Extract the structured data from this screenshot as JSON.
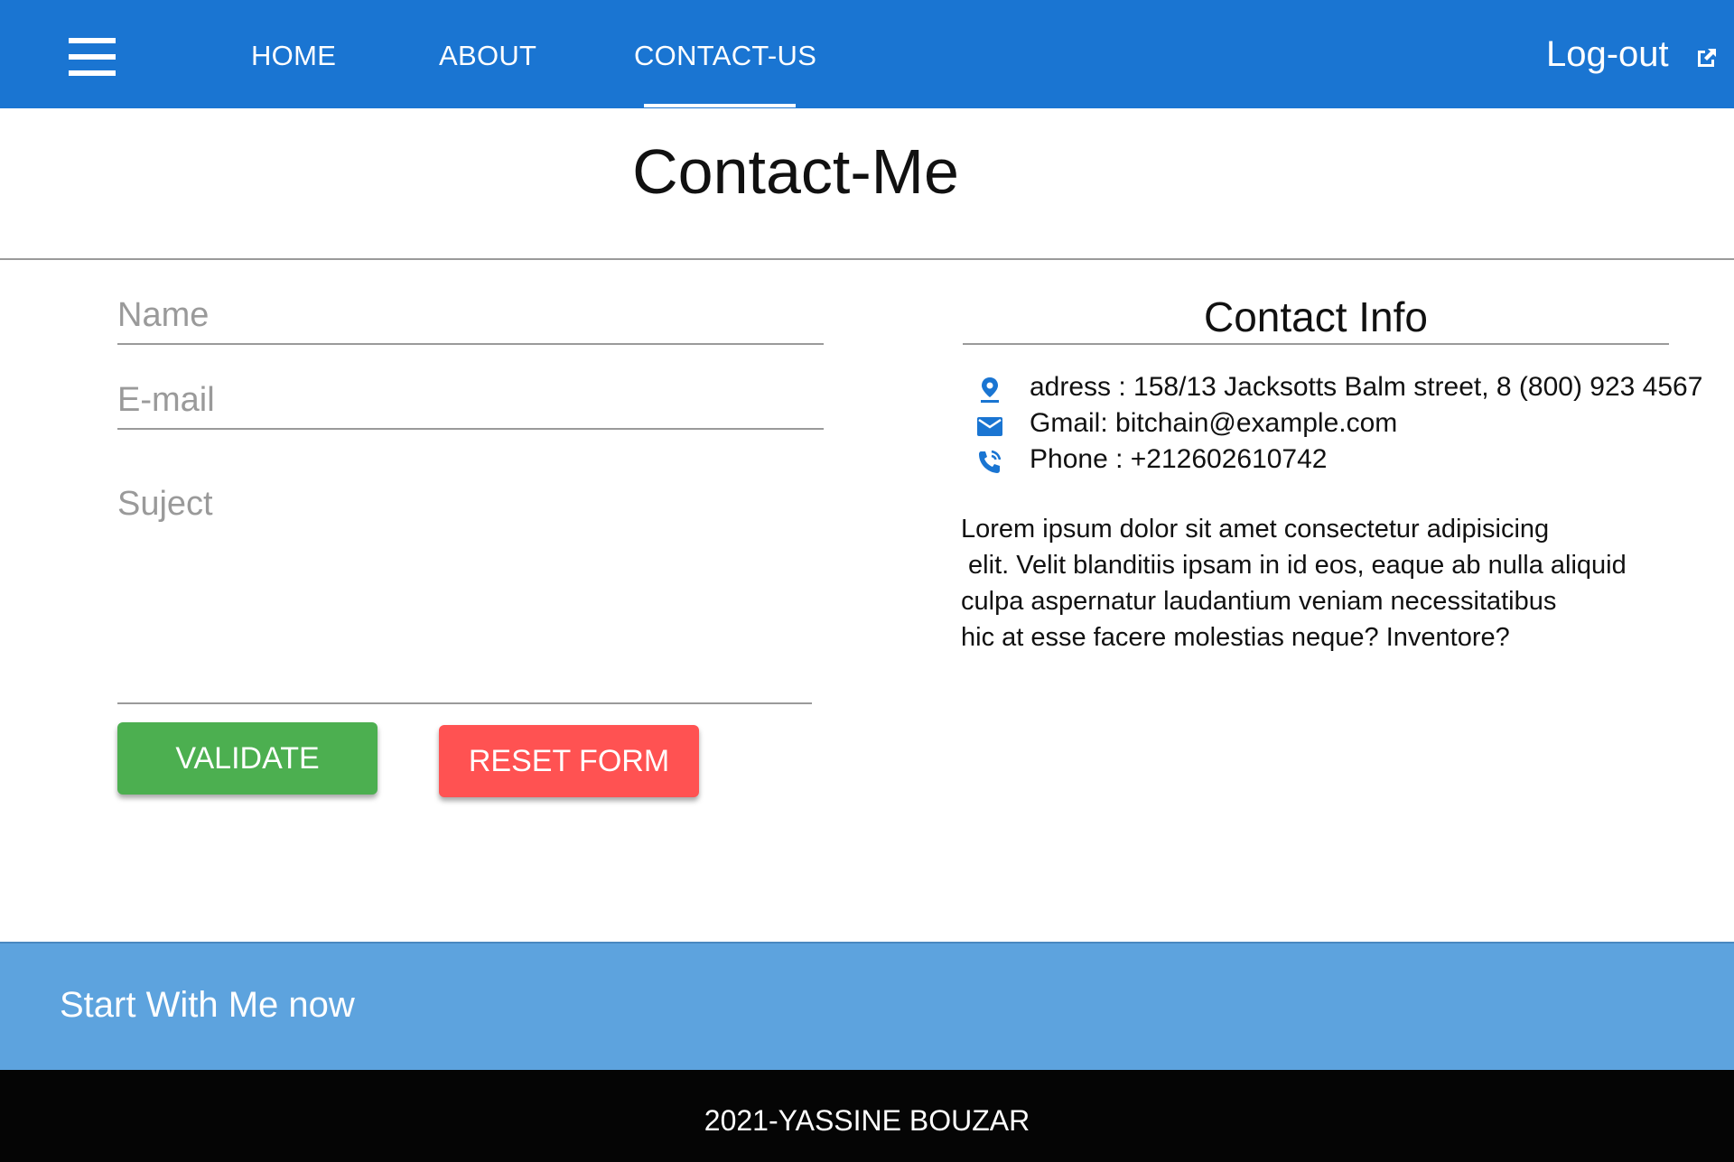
{
  "colors": {
    "nav_bg": "#1a75d2",
    "cta_bg": "#5da3de",
    "footer_bg": "#050505",
    "validate_bg": "#4caf50",
    "reset_bg": "#ff5252",
    "icon_color": "#1a75d2"
  },
  "nav": {
    "menu_icon": "hamburger-icon",
    "links": [
      "HOME",
      "ABOUT",
      "CONTACT-US"
    ],
    "active": "CONTACT-US",
    "logout_label": "Log-out",
    "logout_icon": "external-link-icon"
  },
  "page": {
    "title": "Contact-Me"
  },
  "form": {
    "name_placeholder": "Name",
    "email_placeholder": "E-mail",
    "subject_placeholder": "Suject",
    "validate_label": "VALIDATE",
    "reset_label": "RESET FORM"
  },
  "contact_info": {
    "title": "Contact Info",
    "address": "adress : 158/13 Jacksotts Balm street, 8 (800) 923 4567",
    "address_icon": "location-pin-icon",
    "gmail": "Gmail: bitchain@example.com",
    "gmail_icon": "mail-icon",
    "phone": "Phone : +212602610742",
    "phone_icon": "phone-icon",
    "description": "Lorem ipsum dolor sit amet consectetur adipisicing\n elit. Velit blanditiis ipsam in id eos, eaque ab nulla aliquid\nculpa aspernatur laudantium veniam necessitatibus\nhic at esse facere molestias neque? Inventore?"
  },
  "cta": {
    "text": "Start With Me now"
  },
  "footer": {
    "text": "2021-YASSINE BOUZAR"
  }
}
